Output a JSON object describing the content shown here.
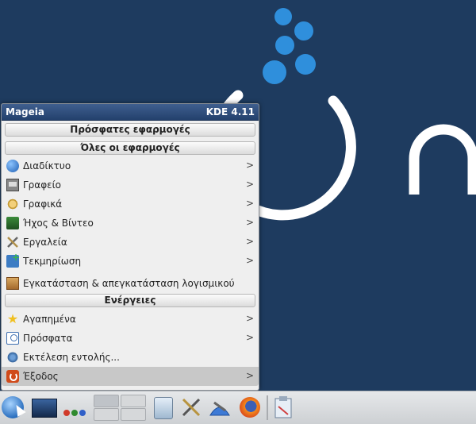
{
  "menu": {
    "header_left": "Mageia",
    "header_right": "KDE 4.11",
    "recent_apps_header": "Πρόσφατες εφαρμογές",
    "all_apps_header": "Όλες οι εφαρμογές",
    "categories": [
      {
        "label": "Διαδίκτυο",
        "icon": "globe-icon"
      },
      {
        "label": "Γραφείο",
        "icon": "office-icon"
      },
      {
        "label": "Γραφικά",
        "icon": "graphics-icon"
      },
      {
        "label": "Ήχος & Βίντεο",
        "icon": "multimedia-icon"
      },
      {
        "label": "Εργαλεία",
        "icon": "tools-icon"
      },
      {
        "label": "Τεκμηρίωση",
        "icon": "documentation-icon"
      }
    ],
    "install_label": "Εγκατάσταση & απεγκατάσταση λογισμικού",
    "actions_header": "Ενέργειες",
    "actions": [
      {
        "label": "Αγαπημένα",
        "icon": "star-icon"
      },
      {
        "label": "Πρόσφατα",
        "icon": "recent-documents-icon"
      },
      {
        "label": "Εκτέλεση εντολής...",
        "icon": "run-command-icon"
      },
      {
        "label": "Έξοδος",
        "icon": "exit-icon"
      }
    ],
    "submenu_arrow": ">"
  },
  "colors": {
    "desktop_background": "#1e3b5f",
    "bubble_blue": "#2f8fdc",
    "menu_header": "#2a4877"
  },
  "taskbar": {
    "items": [
      "application-launcher-icon",
      "show-desktop-icon",
      "activity-dots-icon",
      "pager-icon",
      "monitor-icon",
      "tools-icon",
      "mageia-control-center-icon",
      "firefox-icon",
      "clipboard-icon"
    ]
  }
}
